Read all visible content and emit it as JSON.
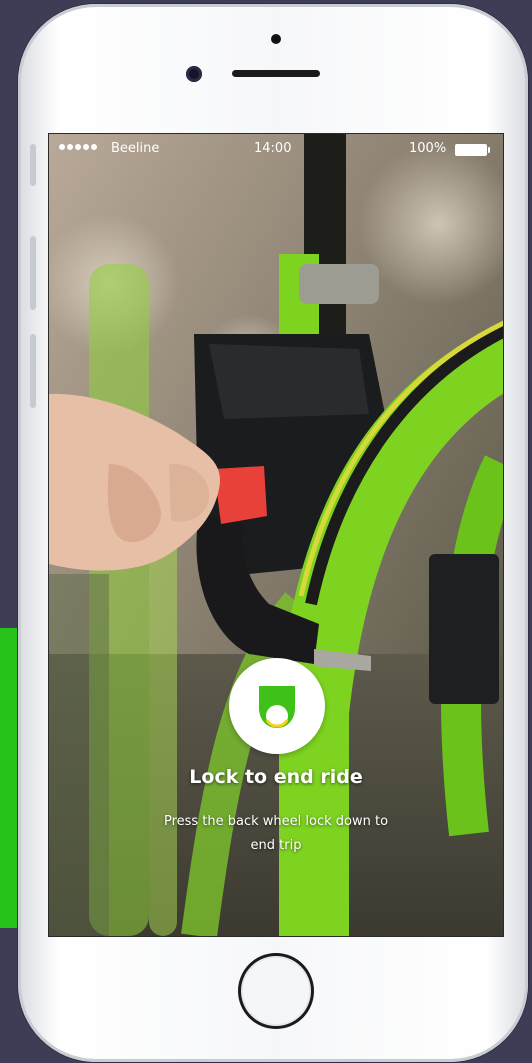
{
  "status_bar": {
    "carrier": "Beeline",
    "time": "14:00",
    "battery": "100%"
  },
  "lock_screen": {
    "icon": "bike-lock-icon",
    "title": "Lock to end ride",
    "subtitle": "Press the back wheel lock down to end trip"
  },
  "colors": {
    "accent_green": "#27c21a",
    "bike_green": "#7ed321",
    "background": "#3d3e55"
  }
}
